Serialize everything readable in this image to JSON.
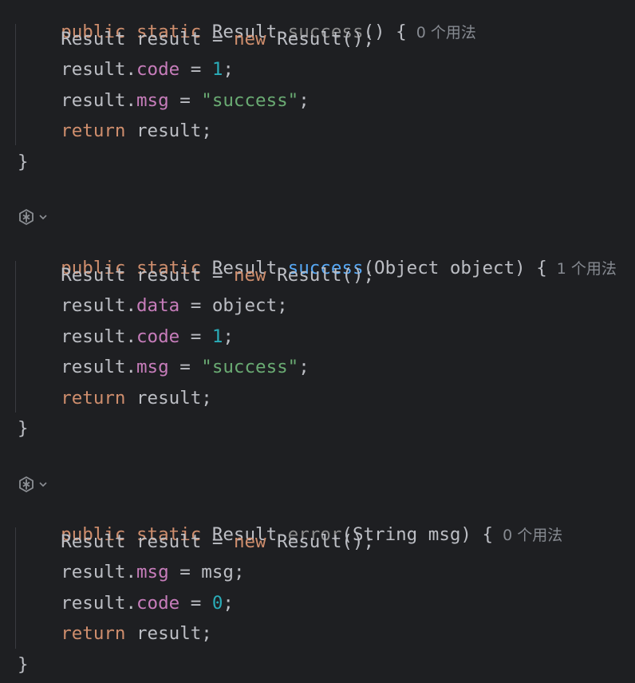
{
  "methods": [
    {
      "signature": {
        "kw1": "public",
        "kw2": "static",
        "type": "Result",
        "name": "success",
        "params_open": "(",
        "params": "",
        "params_close": ")",
        "brace": "{",
        "usages": "0 个用法"
      },
      "body": [
        {
          "a": "Result result = ",
          "b": "new",
          "c": " Result();"
        },
        {
          "obj": "result.",
          "field": "code",
          "eq": " = ",
          "val": "1",
          "end": ";"
        },
        {
          "obj": "result.",
          "field": "msg",
          "eq": " = ",
          "val": "\"success\"",
          "end": ";"
        },
        {
          "kw": "return",
          "rest": " result;"
        }
      ],
      "close": "}"
    },
    {
      "signature": {
        "kw1": "public",
        "kw2": "static",
        "type": "Result",
        "name": "success",
        "params_open": "(",
        "params": "Object object",
        "params_close": ")",
        "brace": "{",
        "usages": "1 个用法"
      },
      "body": [
        {
          "a": "Result result = ",
          "b": "new",
          "c": " Result();"
        },
        {
          "obj": "result.",
          "field": "data",
          "eq": " = ",
          "val": "object",
          "end": ";"
        },
        {
          "obj": "result.",
          "field": "code",
          "eq": " = ",
          "val": "1",
          "end": ";"
        },
        {
          "obj": "result.",
          "field": "msg",
          "eq": " = ",
          "val": "\"success\"",
          "end": ";"
        },
        {
          "kw": "return",
          "rest": " result;"
        }
      ],
      "close": "}"
    },
    {
      "signature": {
        "kw1": "public",
        "kw2": "static",
        "type": "Result",
        "name": "error",
        "params_open": "(",
        "params": "String msg",
        "params_close": ")",
        "brace": "{",
        "usages": "0 个用法"
      },
      "body": [
        {
          "a": "Result result = ",
          "b": "new",
          "c": " Result();"
        },
        {
          "obj": "result.",
          "field": "msg",
          "eq": " = ",
          "val": "msg",
          "end": ";"
        },
        {
          "obj": "result.",
          "field": "code",
          "eq": " = ",
          "val": "0",
          "end": ";"
        },
        {
          "kw": "return",
          "rest": " result;"
        }
      ],
      "close": "}"
    }
  ],
  "gutter": {
    "ai_icon": "ai-assistant-icon",
    "chevron": "chevron-down-icon"
  },
  "colors": {
    "background": "#1e1f22",
    "keyword": "#cf8e6d",
    "method": "#56a8f5",
    "unused_method": "#8c8c8c",
    "field": "#c77dbb",
    "number": "#2aacb8",
    "string": "#6aab73",
    "text": "#bcbec4",
    "hint": "#868a91"
  }
}
